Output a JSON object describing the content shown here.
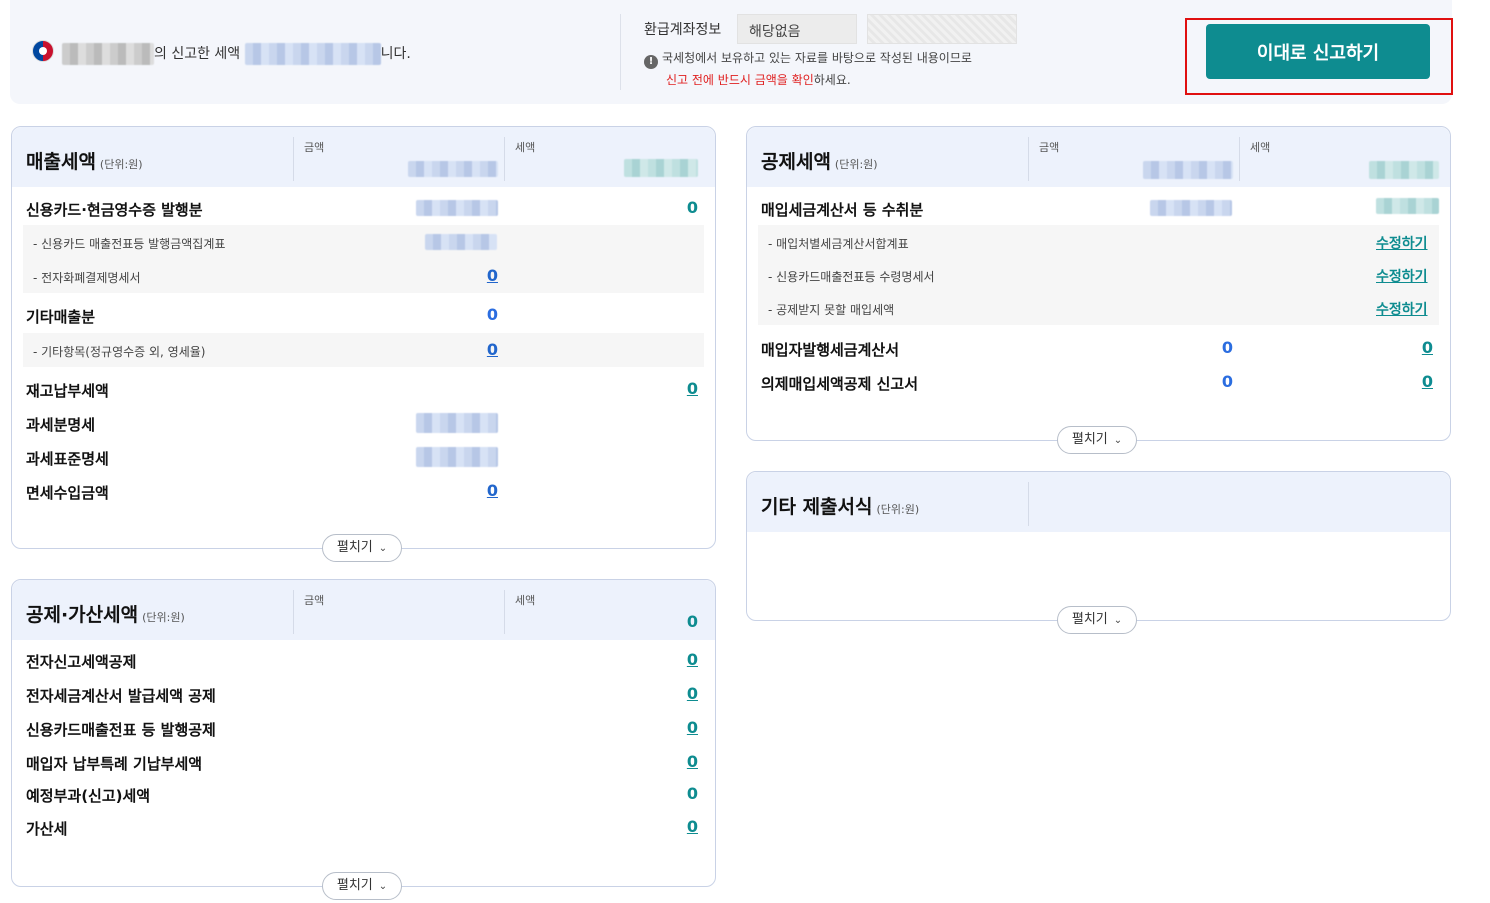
{
  "top": {
    "greeting_suffix_1": "의 신고한 세액",
    "greeting_suffix_2": "니다.",
    "refund_label": "환급계좌정보",
    "refund_value": "해당없음",
    "notice_line1": "국세청에서 보유하고 있는 자료를 바탕으로 작성된 내용이므로",
    "notice_red": "신고 전에 반드시 금액을 확인",
    "notice_end": "하세요.",
    "submit_label": "이대로 신고하기"
  },
  "sales": {
    "title": "매출세액",
    "unit": "(단위:원)",
    "col_amount": "금액",
    "col_tax": "세액",
    "rows": {
      "card": "신용카드·현금영수증 발행분",
      "card_tax": "0",
      "card_sub1": "- 신용카드 매출전표등 발행금액집계표",
      "card_sub2": "- 전자화폐결제명세서",
      "card_sub2_val": "0",
      "other": "기타매출분",
      "other_val": "0",
      "other_sub": "- 기타항목(정규영수증 외, 영세율)",
      "other_sub_val": "0",
      "inventory": "재고납부세액",
      "inventory_tax": "0",
      "tax_detail": "과세분명세",
      "std_detail": "과세표준명세",
      "exempt": "면세수입금액",
      "exempt_val": "0"
    },
    "expand": "펼치기"
  },
  "deduct_add": {
    "title": "공제·가산세액",
    "unit": "(단위:원)",
    "col_amount": "금액",
    "col_tax": "세액",
    "head_total": "0",
    "rows": [
      {
        "label": "전자신고세액공제",
        "val": "0"
      },
      {
        "label": "전자세금계산서 발급세액 공제",
        "val": "0"
      },
      {
        "label": "신용카드매출전표 등 발행공제",
        "val": "0"
      },
      {
        "label": "매입자 납부특례 기납부세액",
        "val": "0"
      },
      {
        "label": "예정부과(신고)세액",
        "val": "0"
      },
      {
        "label": "가산세",
        "val": "0"
      }
    ],
    "expand": "펼치기"
  },
  "purchase": {
    "title": "공제세액",
    "unit": "(단위:원)",
    "col_amount": "금액",
    "col_tax": "세액",
    "rows": {
      "invoice": "매입세금계산서 등 수취분",
      "sub1": "- 매입처별세금계산서합계표",
      "sub2": "- 신용카드매출전표등 수령명세서",
      "sub3": "- 공제받지 못할 매입세액",
      "edit": "수정하기",
      "buyer_invoice": "매입자발행세금계산서",
      "buyer_amount": "0",
      "buyer_tax": "0",
      "deemed": "의제매입세액공제 신고서",
      "deemed_amount": "0",
      "deemed_tax": "0"
    },
    "expand": "펼치기"
  },
  "other_forms": {
    "title": "기타 제출서식",
    "unit": "(단위:원)",
    "expand": "펼치기"
  }
}
